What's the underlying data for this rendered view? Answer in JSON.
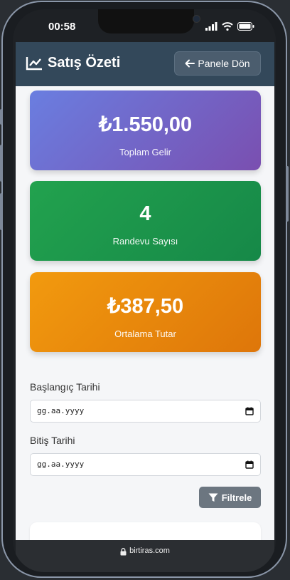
{
  "status_bar": {
    "time": "00:58"
  },
  "header": {
    "title": "Satış Özeti",
    "back_label": "Panele Dön"
  },
  "stats": [
    {
      "value": "₺1.550,00",
      "label": "Toplam Gelir"
    },
    {
      "value": "4",
      "label": "Randevu Sayısı"
    },
    {
      "value": "₺387,50",
      "label": "Ortalama Tutar"
    }
  ],
  "filters": {
    "start_label": "Başlangıç Tarihi",
    "start_value": "gg.aa.yyyy",
    "end_label": "Bitiş Tarihi",
    "end_value": "gg.aa.yyyy",
    "filter_label": "Filtrele"
  },
  "browser": {
    "url": "birtiras.com"
  },
  "colors": {
    "header_bg": "#33485a",
    "revenue_card": "#6f6ad0",
    "count_card": "#1e9a4c",
    "average_card": "#e8880c",
    "filter_button": "#6c7680"
  }
}
